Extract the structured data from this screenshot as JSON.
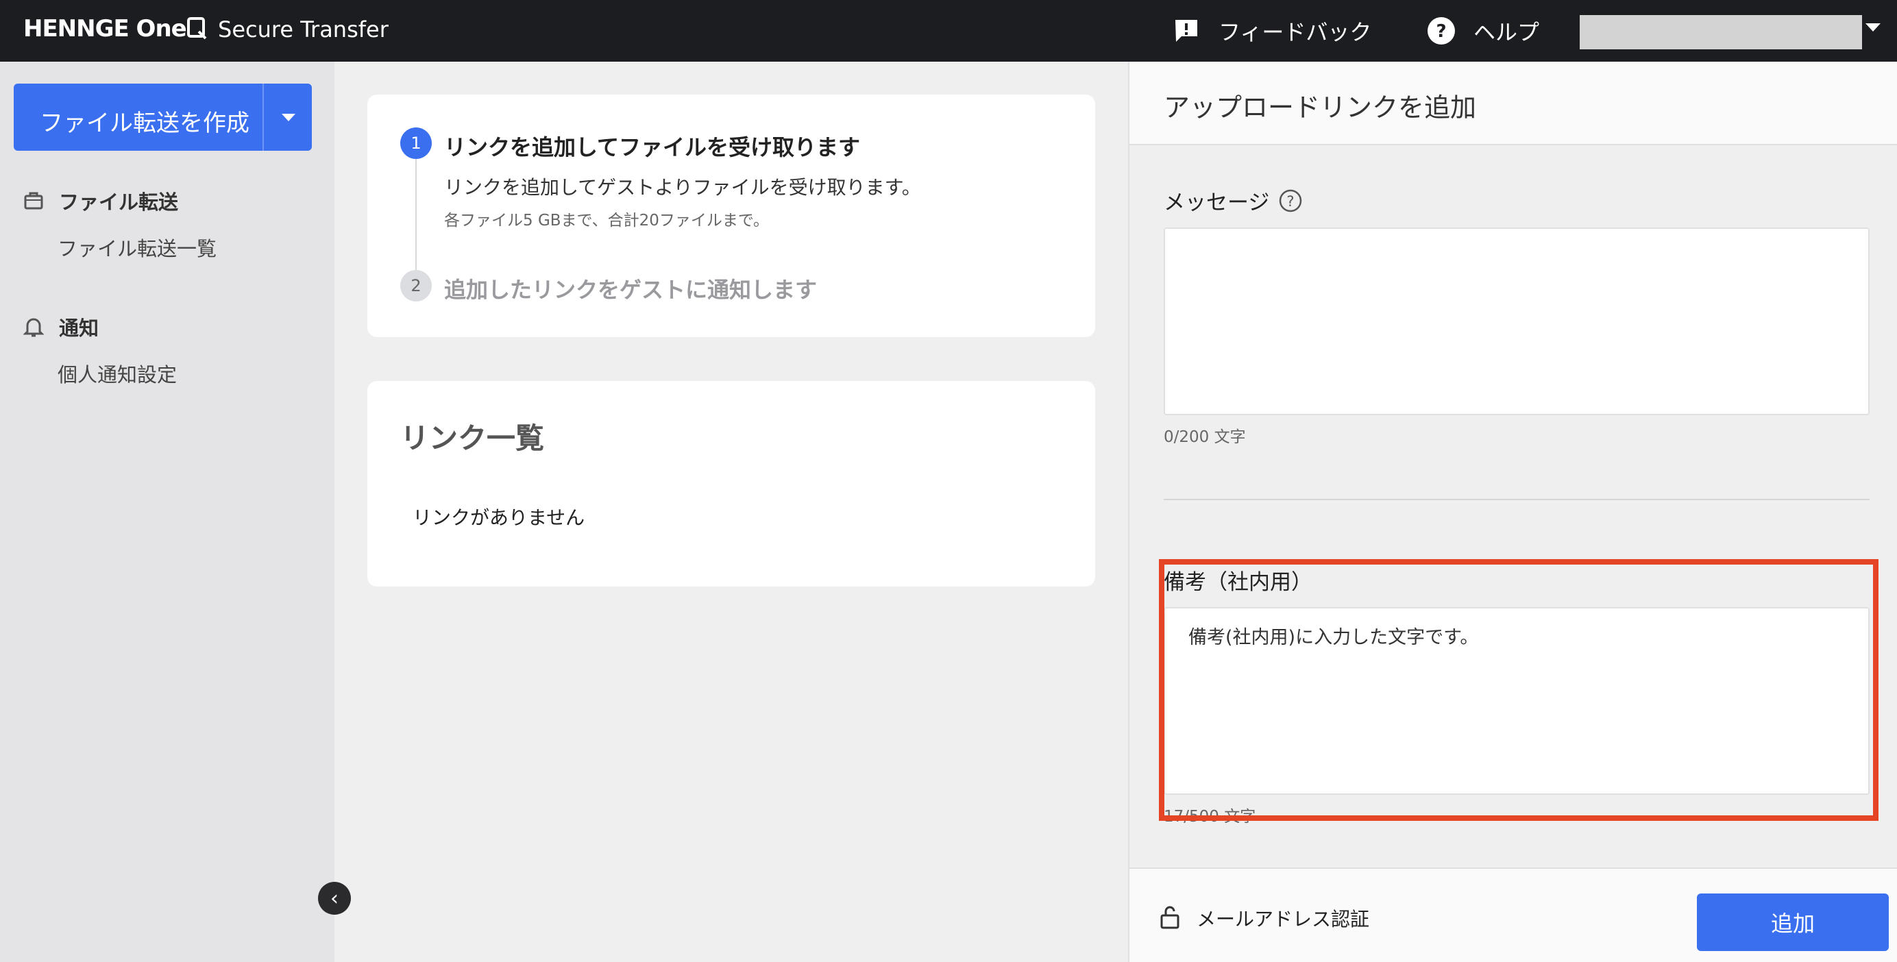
{
  "header": {
    "logo": "HENNGE One",
    "product": "Secure Transfer",
    "feedback": "フィードバック",
    "help": "ヘルプ"
  },
  "sidebar": {
    "create_button": "ファイル転送を作成",
    "sections": [
      {
        "title": "ファイル転送",
        "icon": "briefcase-icon",
        "items": [
          "ファイル転送一覧"
        ]
      },
      {
        "title": "通知",
        "icon": "bell-icon",
        "items": [
          "個人通知設定"
        ]
      }
    ],
    "collapse": "‹"
  },
  "steps": [
    {
      "num": "1",
      "title": "リンクを追加してファイルを受け取ります",
      "desc": "リンクを追加してゲストよりファイルを受け取ります。",
      "note": "各ファイル5 GBまで、合計20ファイルまで。"
    },
    {
      "num": "2",
      "title": "追加したリンクをゲストに通知します"
    }
  ],
  "links": {
    "title": "リンク一覧",
    "empty": "リンクがありません"
  },
  "panel": {
    "title": "アップロードリンクを追加",
    "message": {
      "label": "メッセージ",
      "value": "",
      "counter": "0/200 文字"
    },
    "memo": {
      "label": "備考（社内用）",
      "value": "備考(社内用)に入力した文字です。",
      "counter": "17/500 文字"
    },
    "auth_label": "メールアドレス認証",
    "add_button": "追加"
  },
  "colors": {
    "accent": "#3a6ff0",
    "highlight": "#e44524",
    "header_bg": "#1c1d21"
  }
}
